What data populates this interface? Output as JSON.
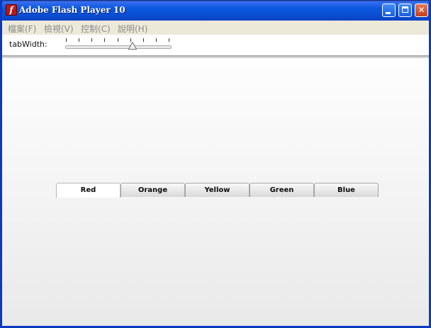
{
  "window": {
    "title": "Adobe Flash Player 10",
    "app_icon_glyph": "f",
    "controls": {
      "minimize": "minimize-icon",
      "maximize": "maximize-icon",
      "close": "close-icon",
      "close_glyph": "✕"
    }
  },
  "menubar": {
    "items": [
      {
        "label": "檔案(F)"
      },
      {
        "label": "檢視(V)"
      },
      {
        "label": "控制(C)"
      },
      {
        "label": "說明(H)"
      }
    ]
  },
  "controls": {
    "tab_width_label": "tabWidth:",
    "slider_position": 0.64
  },
  "tabs": {
    "selected_index": 0,
    "items": [
      {
        "label": "Red"
      },
      {
        "label": "Orange"
      },
      {
        "label": "Yellow"
      },
      {
        "label": "Green"
      },
      {
        "label": "Blue"
      }
    ]
  },
  "colors": {
    "titlebar": "#0b58e0",
    "close_button": "#c6401c",
    "menu_text_disabled": "#8b8b8b"
  }
}
